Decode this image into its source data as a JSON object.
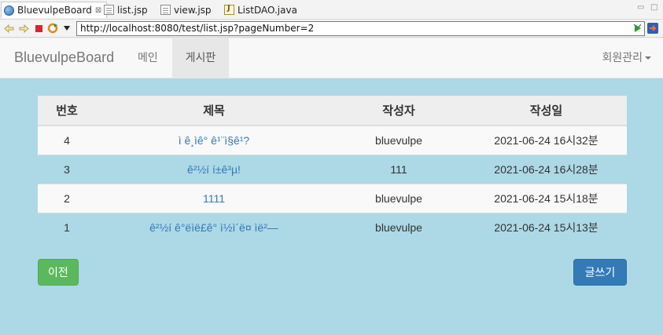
{
  "editor_tabs": [
    {
      "label": "BluevulpeBoard",
      "icon": "globe-icon",
      "active": true,
      "close": "⊠"
    },
    {
      "label": "list.jsp",
      "icon": "file-icon"
    },
    {
      "label": "view.jsp",
      "icon": "file-icon"
    },
    {
      "label": "ListDAO.java",
      "icon": "java-file-icon"
    }
  ],
  "window_controls": {
    "minimize": "▭",
    "maximize": "□"
  },
  "browser": {
    "url": "http://localhost:8080/test/list.jsp?pageNumber=2"
  },
  "navbar": {
    "brand": "BluevulpeBoard",
    "links": [
      {
        "label": "메인",
        "active": false
      },
      {
        "label": "게시판",
        "active": true
      }
    ],
    "right_menu": "회원관리"
  },
  "table": {
    "headers": [
      "번호",
      "제목",
      "작성자",
      "작성일"
    ],
    "rows": [
      {
        "num": "4",
        "title": "ì ê¸ìê° ê¹¨ì§ê¹?",
        "author": "bluevulpe",
        "date": "2021-06-24 16시32분"
      },
      {
        "num": "3",
        "title": "ê²½í í±ê³µ!",
        "author": "111",
        "date": "2021-06-24 16시28분"
      },
      {
        "num": "2",
        "title": "1111",
        "author": "bluevulpe",
        "date": "2021-06-24 15시18분"
      },
      {
        "num": "1",
        "title": "ê²½í ê°ëìë£ê° ì½ì´ë¤ ìë²—",
        "author": "bluevulpe",
        "date": "2021-06-24 15시13분"
      }
    ]
  },
  "buttons": {
    "prev": "이전",
    "write": "글쓰기"
  },
  "colors": {
    "page_background": "#add8e6",
    "link": "#337ab7",
    "success": "#5cb85c",
    "primary": "#337ab7"
  }
}
